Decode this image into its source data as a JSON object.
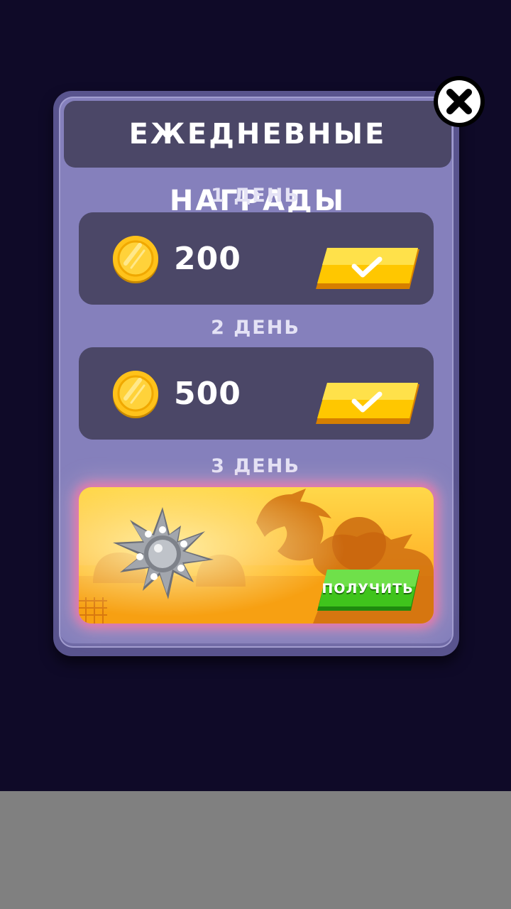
{
  "dialog": {
    "title": "ЕЖЕДНЕВНЫЕ НАГРАДЫ",
    "close_icon": "close-icon"
  },
  "rewards": [
    {
      "day_label": "1 ДЕНЬ",
      "type": "coins",
      "amount": "200",
      "status": "claimed",
      "button_icon": "checkmark-icon"
    },
    {
      "day_label": "2 ДЕНЬ",
      "type": "coins",
      "amount": "500",
      "status": "claimed",
      "button_icon": "checkmark-icon"
    },
    {
      "day_label": "3 ДЕНЬ",
      "type": "item",
      "item_icon": "shuriken-icon",
      "status": "available",
      "button_label": "ПОЛУЧИТЬ"
    }
  ],
  "colors": {
    "background": "#0f0a28",
    "panel": "#8580bc",
    "row": "#4b4767",
    "claimed_button": "#f5b400",
    "get_button": "#3fc41c",
    "bottom_bar": "#808080"
  }
}
